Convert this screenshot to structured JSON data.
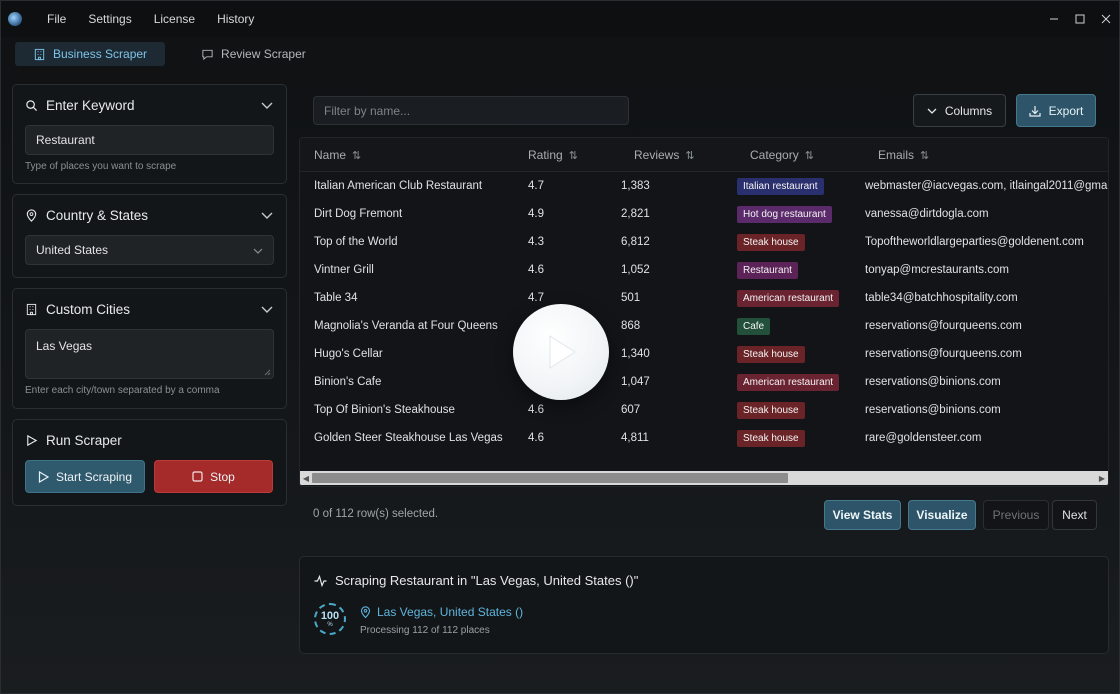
{
  "menubar": {
    "items": [
      "File",
      "Settings",
      "License",
      "History"
    ]
  },
  "tabs": [
    {
      "label": "Business Scraper"
    },
    {
      "label": "Review Scraper"
    }
  ],
  "sidebar": {
    "keyword": {
      "title": "Enter Keyword",
      "value": "Restaurant",
      "hint": "Type of places you want to scrape"
    },
    "country": {
      "title": "Country & States",
      "value": "United States"
    },
    "cities": {
      "title": "Custom Cities",
      "value": "Las Vegas",
      "hint": "Enter each city/town separated by a comma"
    },
    "run": {
      "title": "Run Scraper",
      "start_label": "Start Scraping",
      "stop_label": "Stop"
    }
  },
  "toolbar": {
    "filter_placeholder": "Filter by name...",
    "columns_label": "Columns",
    "export_label": "Export"
  },
  "table": {
    "headers": [
      "Name",
      "Rating",
      "Reviews",
      "Category",
      "Emails"
    ],
    "rows": [
      {
        "name": "Italian American Club Restaurant",
        "rating": "4.7",
        "reviews": "1,383",
        "category": "Italian restaurant",
        "cat_color": "#2a2f6e",
        "email": "webmaster@iacvegas.com, itlaingal2011@gmai"
      },
      {
        "name": "Dirt Dog Fremont",
        "rating": "4.9",
        "reviews": "2,821",
        "category": "Hot dog restaurant",
        "cat_color": "#5b2a6a",
        "email": "vanessa@dirtdogla.com"
      },
      {
        "name": "Top of the World",
        "rating": "4.3",
        "reviews": "6,812",
        "category": "Steak house",
        "cat_color": "#6a2326",
        "email": "Topoftheworldlargeparties@goldenent.com"
      },
      {
        "name": "Vintner Grill",
        "rating": "4.6",
        "reviews": "1,052",
        "category": "Restaurant",
        "cat_color": "#5b2358",
        "email": "tonyap@mcrestaurants.com"
      },
      {
        "name": "Table 34",
        "rating": "4.7",
        "reviews": "501",
        "category": "American restaurant",
        "cat_color": "#6a2330",
        "email": "table34@batchhospitality.com"
      },
      {
        "name": "Magnolia's Veranda at Four Queens",
        "rating": "",
        "reviews": "868",
        "category": "Cafe",
        "cat_color": "#22503a",
        "email": "reservations@fourqueens.com"
      },
      {
        "name": "Hugo's Cellar",
        "rating": "",
        "reviews": "1,340",
        "category": "Steak house",
        "cat_color": "#6a2326",
        "email": "reservations@fourqueens.com"
      },
      {
        "name": "Binion's Cafe",
        "rating": "",
        "reviews": "1,047",
        "category": "American restaurant",
        "cat_color": "#6a2330",
        "email": "reservations@binions.com"
      },
      {
        "name": "Top Of Binion's Steakhouse",
        "rating": "4.6",
        "reviews": "607",
        "category": "Steak house",
        "cat_color": "#6a2326",
        "email": "reservations@binions.com"
      },
      {
        "name": "Golden Steer Steakhouse Las Vegas",
        "rating": "4.6",
        "reviews": "4,811",
        "category": "Steak house",
        "cat_color": "#6a2326",
        "email": "rare@goldensteer.com"
      }
    ]
  },
  "pagination": {
    "selected_text": "0 of 112 row(s) selected.",
    "view_stats": "View Stats",
    "visualize": "Visualize",
    "previous": "Previous",
    "next": "Next"
  },
  "progress": {
    "title": "Scraping Restaurant in \"Las Vegas, United States ()\"",
    "percent": "100",
    "percent_sign": "%",
    "location": "Las Vegas, United States ()",
    "status": "Processing 112 of 112 places"
  },
  "colors": {
    "accent": "#4aa8c8",
    "stop": "#a52a2a",
    "primary": "#2d5468"
  }
}
